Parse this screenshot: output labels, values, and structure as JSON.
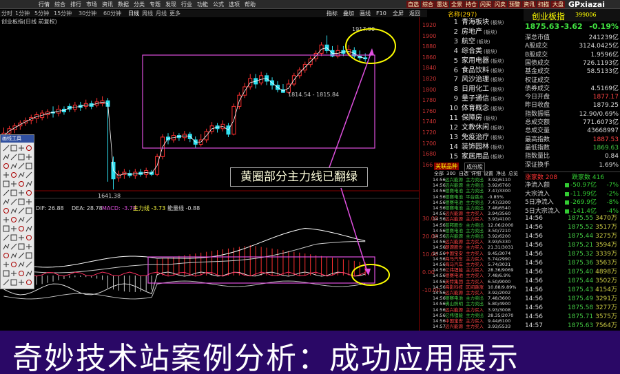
{
  "nav": {
    "items": [
      "分时",
      "1分钟",
      "5分钟",
      "15分钟",
      "30分钟",
      "60分钟",
      "日线",
      "周线",
      "月线",
      "更多"
    ],
    "menu": [
      "行情",
      "综合",
      "排行",
      "市场",
      "资讯",
      "数据",
      "分类",
      "专题",
      "发现",
      "行业",
      "功能",
      "公式",
      "选项",
      "帮助"
    ],
    "right_tabs": [
      "自选",
      "综合",
      "雷达",
      "全景",
      "持仓",
      "闪买",
      "闪卖",
      "预警",
      "资讯",
      "扫描",
      "大盘"
    ],
    "top_right_buttons": [
      "指标",
      "叠加",
      "画线",
      "F10",
      "全屏",
      "返回"
    ]
  },
  "logo": "GPxiazai",
  "chart": {
    "title": "创业板指(日线 前复权)",
    "high_label": "1917.90",
    "range_label": "1814.54 - 1815.84",
    "low_label": "1641.38",
    "macd_legend": {
      "diff": "DIF: 26.88",
      "dea": "DEA: 28.78",
      "macd": "MACD: -3.78",
      "main": "主力线 -3.73",
      "energy": "能量线 -0.88"
    },
    "annotation": "黄圈部分主力线已翻绿",
    "candles": [
      [
        1733,
        1742,
        1725,
        1752
      ],
      [
        1742,
        1750,
        1735,
        1755
      ],
      [
        1748,
        1755,
        1742,
        1760
      ],
      [
        1755,
        1760,
        1748,
        1765
      ],
      [
        1760,
        1765,
        1755,
        1770
      ],
      [
        1765,
        1770,
        1758,
        1775
      ],
      [
        1768,
        1775,
        1760,
        1780
      ],
      [
        1770,
        1778,
        1765,
        1783
      ],
      [
        1775,
        1780,
        1768,
        1785
      ],
      [
        1780,
        1778,
        1770,
        1790
      ],
      [
        1778,
        1785,
        1772,
        1792
      ],
      [
        1785,
        1780,
        1775,
        1790
      ],
      [
        1790,
        1785,
        1780,
        1795
      ],
      [
        1785,
        1792,
        1780,
        1798
      ],
      [
        1792,
        1788,
        1782,
        1798
      ],
      [
        1790,
        1795,
        1785,
        1802
      ],
      [
        1795,
        1790,
        1785,
        1800
      ],
      [
        1792,
        1798,
        1788,
        1805
      ],
      [
        1795,
        1800,
        1790,
        1808
      ],
      [
        1800,
        1790,
        1655,
        1805
      ],
      [
        1690,
        1660,
        1641,
        1700
      ],
      [
        1662,
        1668,
        1655,
        1675
      ],
      [
        1668,
        1672,
        1660,
        1678
      ],
      [
        1670,
        1666,
        1662,
        1676
      ],
      [
        1666,
        1672,
        1660,
        1678
      ],
      [
        1672,
        1668,
        1664,
        1678
      ],
      [
        1668,
        1675,
        1662,
        1680
      ],
      [
        1672,
        1668,
        1665,
        1676
      ],
      [
        1668,
        1700,
        1665,
        1705
      ],
      [
        1700,
        1735,
        1695,
        1740
      ],
      [
        1735,
        1730,
        1722,
        1742
      ],
      [
        1730,
        1738,
        1725,
        1744
      ],
      [
        1738,
        1734,
        1728,
        1742
      ],
      [
        1734,
        1740,
        1728,
        1746
      ],
      [
        1740,
        1732,
        1726,
        1744
      ],
      [
        1730,
        1722,
        1715,
        1736
      ],
      [
        1722,
        1730,
        1718,
        1740
      ],
      [
        1730,
        1745,
        1725,
        1750
      ],
      [
        1745,
        1755,
        1740,
        1762
      ],
      [
        1755,
        1750,
        1743,
        1760
      ],
      [
        1750,
        1758,
        1745,
        1765
      ],
      [
        1755,
        1740,
        1735,
        1760
      ],
      [
        1740,
        1790,
        1738,
        1795
      ],
      [
        1790,
        1810,
        1785,
        1815
      ],
      [
        1810,
        1825,
        1805,
        1832
      ],
      [
        1825,
        1840,
        1820,
        1848
      ],
      [
        1840,
        1830,
        1822,
        1848
      ],
      [
        1832,
        1845,
        1828,
        1852
      ],
      [
        1845,
        1835,
        1828,
        1850
      ],
      [
        1836,
        1828,
        1820,
        1842
      ],
      [
        1828,
        1820,
        1815,
        1835
      ],
      [
        1820,
        1815,
        1814,
        1830
      ],
      [
        1815,
        1830,
        1812,
        1838
      ],
      [
        1830,
        1845,
        1826,
        1850
      ],
      [
        1845,
        1855,
        1840,
        1860
      ],
      [
        1855,
        1865,
        1850,
        1870
      ],
      [
        1865,
        1875,
        1860,
        1880
      ],
      [
        1875,
        1885,
        1870,
        1890
      ],
      [
        1885,
        1900,
        1880,
        1905
      ],
      [
        1900,
        1890,
        1885,
        1917
      ],
      [
        1890,
        1880,
        1878,
        1898
      ],
      [
        1880,
        1890,
        1876,
        1900
      ],
      [
        1890,
        1885,
        1880,
        1898
      ],
      [
        1885,
        1892,
        1880,
        1900
      ],
      [
        1890,
        1880,
        1876,
        1896
      ],
      [
        1880,
        1877,
        1872,
        1890
      ],
      [
        1877,
        1875,
        1870,
        1885
      ]
    ]
  },
  "axis": {
    "price": [
      "1920",
      "1900",
      "1880",
      "1860",
      "1840",
      "1820",
      "1800",
      "1780",
      "1760",
      "1740",
      "1720",
      "1700",
      "1680",
      "1660"
    ],
    "macd": [
      "30.00",
      "20.00",
      "10.00",
      "0.00",
      "-10.00"
    ]
  },
  "sector_list": {
    "header": "名称(297)",
    "items": [
      {
        "n": "1",
        "name": "青海板块",
        "tag": "(板块)"
      },
      {
        "n": "2",
        "name": "房地产",
        "tag": "(板块)"
      },
      {
        "n": "3",
        "name": "航空",
        "tag": "(板块)"
      },
      {
        "n": "4",
        "name": "综合类",
        "tag": "(板块)"
      },
      {
        "n": "5",
        "name": "家用电器",
        "tag": "(板块)"
      },
      {
        "n": "6",
        "name": "食品饮料",
        "tag": "(板块)"
      },
      {
        "n": "7",
        "name": "风沙治理",
        "tag": "(板块)"
      },
      {
        "n": "8",
        "name": "日用化工",
        "tag": "(板块)"
      },
      {
        "n": "9",
        "name": "量子通信",
        "tag": "(板块)"
      },
      {
        "n": "10",
        "name": "体育概念",
        "tag": "(板块)"
      },
      {
        "n": "11",
        "name": "保障房",
        "tag": "(板块)"
      },
      {
        "n": "12",
        "name": "文教休闲",
        "tag": "(板块)"
      },
      {
        "n": "13",
        "name": "免疫治疗",
        "tag": "(板块)"
      },
      {
        "n": "14",
        "name": "装饰园林",
        "tag": "(板块)"
      },
      {
        "n": "15",
        "name": "家居用品",
        "tag": "(板块)"
      }
    ],
    "tabs": [
      "关联品种",
      "成份股"
    ],
    "sub_tabs": [
      "全部",
      "300",
      "自选",
      "详细",
      "设置",
      "净出",
      "总览"
    ]
  },
  "quote": {
    "name": "创业板指",
    "code": "399006",
    "price": "1875.63",
    "change": "-3.62",
    "pct": "-0.19%",
    "rows": [
      {
        "l": "深总市值",
        "v": "241239亿"
      },
      {
        "l": "A股成交",
        "v": "3124.0425亿"
      },
      {
        "l": "B股成交",
        "v": "1.9596亿"
      },
      {
        "l": "国债成交",
        "v": "726.1193亿"
      },
      {
        "l": "基金成交",
        "v": "58.5133亿"
      },
      {
        "l": "权证成交",
        "v": ""
      },
      {
        "l": "债券成交",
        "v": "4.5169亿"
      },
      {
        "l": "今日开盘",
        "v": "1877.17"
      },
      {
        "l": "昨日收盘",
        "v": "1879.25"
      },
      {
        "l": "指数振幅",
        "v": "12.90/0.69%"
      },
      {
        "l": "总成交额",
        "v": "771.6073亿"
      },
      {
        "l": "总成交量",
        "v": "43668997"
      },
      {
        "l": "最高指数",
        "v": "1887.53"
      },
      {
        "l": "最低指数",
        "v": "1869.63"
      },
      {
        "l": "指数量比",
        "v": "0.84"
      },
      {
        "l": "深证换手",
        "v": "1.69%"
      }
    ],
    "up": "涨家数 208",
    "down": "跌家数 416",
    "flows": [
      {
        "l": "净流入额",
        "v": "-50.97亿",
        "p": "-7%"
      },
      {
        "l": "大宗流入",
        "v": "-11.99亿",
        "p": "-2%"
      },
      {
        "l": "5日净流入",
        "v": "-269.9亿",
        "p": "-8%"
      },
      {
        "l": "5日大宗流入",
        "v": "-141.4亿",
        "p": "-4%"
      }
    ],
    "ticks": [
      [
        "14:56",
        "1875.55",
        "3470万"
      ],
      [
        "14:56",
        "1875.52",
        "3517万"
      ],
      [
        "14:56",
        "1875.44",
        "3275万"
      ],
      [
        "14:56",
        "1875.21",
        "3594万"
      ],
      [
        "14:56",
        "1875.32",
        "3339万"
      ],
      [
        "14:56",
        "1875.36",
        "3563万"
      ],
      [
        "14:56",
        "1875.40",
        "4898万"
      ],
      [
        "14:56",
        "1875.44",
        "3502万"
      ],
      [
        "14:56",
        "1875.43",
        "4154万"
      ],
      [
        "14:56",
        "1875.49",
        "3291万"
      ],
      [
        "14:56",
        "1875.58",
        "3277万"
      ],
      [
        "14:56",
        "1875.71",
        "3575万"
      ],
      [
        "14:57",
        "1875.63",
        "7564万"
      ]
    ]
  },
  "deals": [
    [
      "14:56",
      "远兴能源",
      "主力卖出",
      "3.92/6110"
    ],
    [
      "14:56",
      "远兴能源",
      "主力卖出",
      "3.92/6760"
    ],
    [
      "14:56",
      "德赛电池",
      "主力卖出",
      "7.47/3300"
    ],
    [
      "14:56",
      "德赛电池",
      "平台跳水",
      "-0.85%"
    ],
    [
      "14:56",
      "德赛电池",
      "主力卖出",
      "7.47/3300"
    ],
    [
      "14:56",
      "德赛电池",
      "主力卖出",
      "7.48/6540"
    ],
    [
      "14:56",
      "远兴能源",
      "主力买入",
      "3.94/3560"
    ],
    [
      "14:56",
      "远兴能源",
      "主力买入",
      "3.93/4100"
    ],
    [
      "14:56",
      "普邦股份",
      "主力卖出",
      "12.06/2000"
    ],
    [
      "14:56",
      "德赛电池",
      "主力卖出",
      "3.50/7210"
    ],
    [
      "14:56",
      "远兴能源",
      "主力卖出",
      "3.92/6200"
    ],
    [
      "14:56",
      "远兴能源",
      "主力买入",
      "3.93/5330"
    ],
    [
      "14:56",
      "朗源股份",
      "主力买入",
      "21.31/3031"
    ],
    [
      "14:56",
      "中国宝安",
      "主力买入",
      "9.45/3074"
    ],
    [
      "14:56",
      "海马汽车",
      "主力买入",
      "5.74/2990"
    ],
    [
      "14:56",
      "海马汽车",
      "主力买入",
      "5.74/3031"
    ],
    [
      "14:56",
      "亿纬锂能",
      "主力买入",
      "28.36/9069"
    ],
    [
      "14:56",
      "德赛电池",
      "主力买入",
      "7.48/6.9%"
    ],
    [
      "14:56",
      "英特集团",
      "主力买入",
      "6.50/9000"
    ],
    [
      "14:56",
      "海影科技",
      "区间跳涨",
      "10.88/9.89%"
    ],
    [
      "14:56",
      "远兴能源",
      "主力买入",
      "3.92/2002"
    ],
    [
      "14:56",
      "德赛电池",
      "主力卖出",
      "7.48/3600"
    ],
    [
      "14:56",
      "佛山照明",
      "主力卖出",
      "5.80/4900"
    ],
    [
      "14:56",
      "远兴能源",
      "主力买入",
      "3.93/3008"
    ],
    [
      "14:56",
      "亿纬锂能",
      "主力卖出",
      "28.35/2070"
    ],
    [
      "14:56",
      "中国宝安",
      "主力买入",
      "9.44/6100"
    ],
    [
      "14:57",
      "远兴能源",
      "主力买入",
      "3.93/5533"
    ]
  ],
  "tools_title": "画线工具",
  "banner": "奇妙技术站案例分析：成功应用展示",
  "colors": {
    "up": "#ff3030",
    "down": "#30e0f0",
    "accent": "#ff50ff",
    "highlight": "#ffff00",
    "banner_bg": "#2a0866"
  }
}
